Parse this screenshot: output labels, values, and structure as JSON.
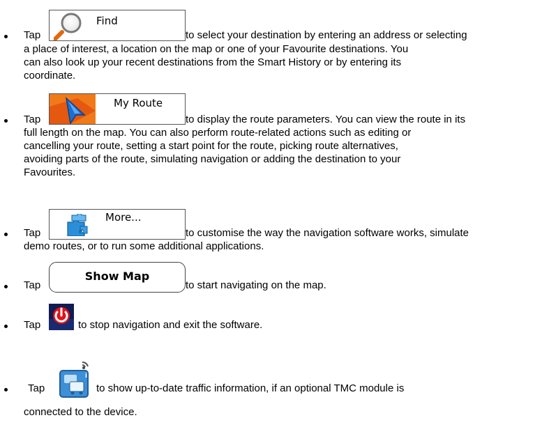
{
  "items": [
    {
      "tap": "Tap",
      "button_label": "Find",
      "icon": "magnifier-icon",
      "lines": [
        "to select your destination by entering an address or selecting",
        "a place of interest, a location on the map or one of your Favourite destinations. You",
        "can also look up your recent destinations from the Smart History or by entering its",
        "coordinate."
      ]
    },
    {
      "tap": "Tap",
      "button_label": "My Route",
      "icon": "route-arrow-icon",
      "lines": [
        "to display the route parameters. You can view the route in its",
        "full length on the map. You can also perform route-related actions such as editing or",
        "cancelling your route, setting a start point for the route, picking route alternatives,",
        "avoiding parts of the route, simulating navigation or adding the destination to your",
        "Favourites."
      ]
    },
    {
      "tap": "Tap",
      "button_label": "More...",
      "icon": "puzzle-icon",
      "lines": [
        "to customise the way the navigation software works, simulate",
        "demo routes, or to run some additional applications."
      ]
    },
    {
      "tap": "Tap",
      "button_label": "Show Map",
      "lines": [
        "to start navigating on the map."
      ]
    },
    {
      "tap": "Tap",
      "icon": "power-icon",
      "lines": [
        "to stop navigation and exit the software."
      ]
    },
    {
      "tap": "Tap",
      "icon": "traffic-tmc-icon",
      "lines": [
        "to show up-to-date traffic information, if an optional TMC module is",
        "connected to the device."
      ]
    }
  ]
}
